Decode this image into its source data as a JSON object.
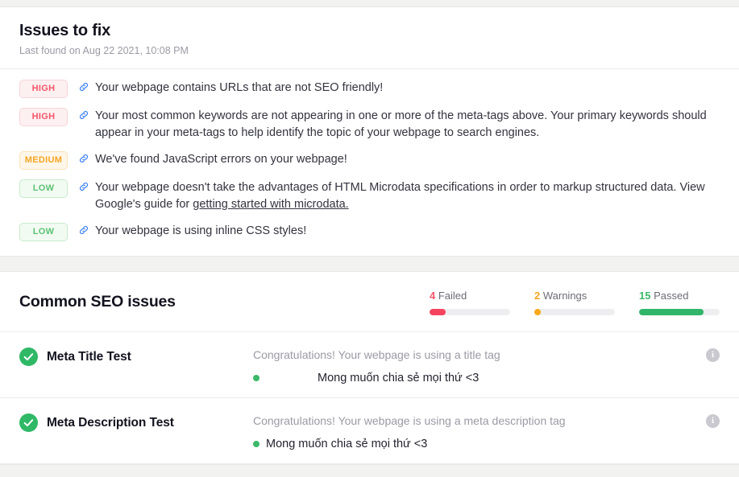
{
  "issues_card": {
    "title": "Issues to fix",
    "subtitle": "Last found on Aug 22 2021, 10:08 PM",
    "issues": [
      {
        "severity": "HIGH",
        "severity_class": "badge-high",
        "icon": "link-icon",
        "text": "Your webpage contains URLs that are not SEO friendly!"
      },
      {
        "severity": "HIGH",
        "severity_class": "badge-high",
        "icon": "link-icon",
        "text": "Your most common keywords are not appearing in one or more of the meta-tags above. Your primary keywords should appear in your meta-tags to help identify the topic of your webpage to search engines."
      },
      {
        "severity": "MEDIUM",
        "severity_class": "badge-medium",
        "icon": "link-icon",
        "text": "We've found JavaScript errors on your webpage!"
      },
      {
        "severity": "LOW",
        "severity_class": "badge-low",
        "icon": "link-icon",
        "text_before": "Your webpage doesn't take the advantages of HTML Microdata specifications in order to markup structured data. View Google's guide for ",
        "link_text": "getting started with microdata.",
        "text": "Your webpage doesn't take the advantages of HTML Microdata specifications in order to markup structured data. View Google's guide for getting started with microdata."
      },
      {
        "severity": "LOW",
        "severity_class": "badge-low",
        "icon": "link-icon",
        "text": "Your webpage is using inline CSS styles!"
      }
    ]
  },
  "seo_card": {
    "title": "Common SEO issues",
    "stats": [
      {
        "count": "4",
        "label": "Failed",
        "type": "failed",
        "fill_percent": "20%",
        "color": "#f4445f"
      },
      {
        "count": "2",
        "label": "Warnings",
        "type": "warning",
        "fill_percent": "8%",
        "color": "#f9a81a"
      },
      {
        "count": "15",
        "label": "Passed",
        "type": "passed",
        "fill_percent": "80%",
        "color": "#30b56a"
      }
    ],
    "tests": [
      {
        "status_icon": "check-circle-icon",
        "name": "Meta Title Test",
        "message": "Congratulations! Your webpage is using a title tag",
        "value": "Mong muốn chia sẻ mọi thứ <3",
        "info_icon": "info-icon"
      },
      {
        "status_icon": "check-circle-icon",
        "name": "Meta Description Test",
        "message": "Congratulations! Your webpage is using a meta description tag",
        "value": "Mong muốn chia sẻ mọi thứ <3",
        "info_icon": "info-icon"
      }
    ]
  }
}
